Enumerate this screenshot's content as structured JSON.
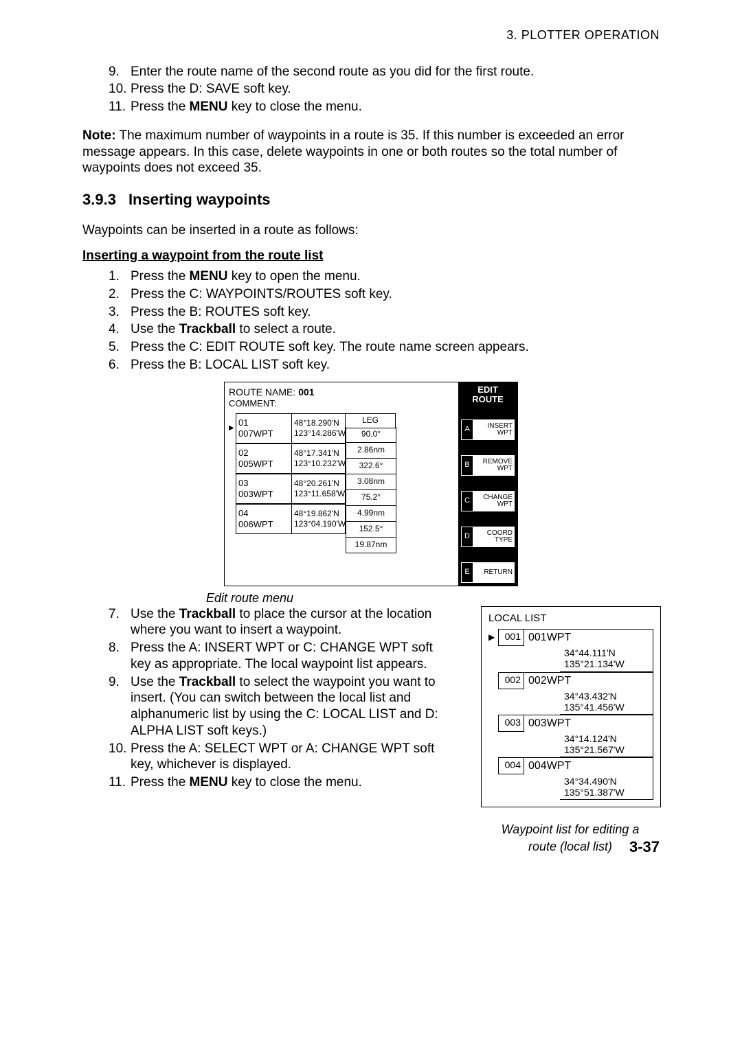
{
  "header": {
    "section_label": "3.  PLOTTER  OPERATION"
  },
  "steps_first": [
    {
      "num": "9.",
      "text": "Enter the route name of the second route as you did for the first route."
    },
    {
      "num": "10.",
      "text": "Press the D: SAVE soft key."
    },
    {
      "num": "11.",
      "text_pre": "Press the ",
      "bold": "MENU",
      "text_post": " key to close the menu."
    }
  ],
  "note": {
    "label": "Note:",
    "text": " The maximum number of waypoints in a route is 35. If this number is exceeded an error message appears. In this case, delete waypoints in one or both routes so the total number of waypoints does not exceed 35."
  },
  "section": {
    "num": "3.9.3",
    "title": "Inserting waypoints"
  },
  "intro": "Waypoints can be inserted in a route as follows:",
  "subhead": "Inserting a waypoint from the route list",
  "steps_second": [
    {
      "num": "1.",
      "pre": "Press the ",
      "bold": "MENU",
      "post": " key to open the menu."
    },
    {
      "num": "2.",
      "pre": "Press the C: WAYPOINTS/ROUTES soft key.",
      "bold": "",
      "post": ""
    },
    {
      "num": "3.",
      "pre": "Press the B: ROUTES soft key.",
      "bold": "",
      "post": ""
    },
    {
      "num": "4.",
      "pre": "Use the ",
      "bold": "Trackball",
      "post": " to select a route."
    },
    {
      "num": "5.",
      "pre": "Press the C: EDIT ROUTE soft key. The route name screen appears.",
      "bold": "",
      "post": ""
    },
    {
      "num": "6.",
      "pre": "Press the B: LOCAL LIST soft key.",
      "bold": "",
      "post": ""
    }
  ],
  "edit_route": {
    "route_name_label": "ROUTE NAME: ",
    "route_name": "001",
    "comment_label": "COMMENT:",
    "leg_header": "LEG",
    "rows": [
      {
        "idx": "01",
        "wpt": "007WPT",
        "lat": "48°18.290'N",
        "lon": "123°14.286'W"
      },
      {
        "idx": "02",
        "wpt": "005WPT",
        "lat": "48°17.341'N",
        "lon": "123°10.232'W"
      },
      {
        "idx": "03",
        "wpt": "003WPT",
        "lat": "48°20.261'N",
        "lon": "123°11.658'W"
      },
      {
        "idx": "04",
        "wpt": "006WPT",
        "lat": "48°19.862'N",
        "lon": "123°04.190'W"
      }
    ],
    "legs": [
      {
        "brg": "90.0°",
        "dst": "2.86nm"
      },
      {
        "brg": "322.6°",
        "dst": "3.08nm"
      },
      {
        "brg": "75.2°",
        "dst": "4.99nm"
      },
      {
        "brg": "152.5°",
        "dst": "19.87nm"
      }
    ],
    "right_title": "EDIT ROUTE",
    "soft_keys": [
      {
        "letter": "A",
        "label": "INSERT WPT"
      },
      {
        "letter": "B",
        "label": "REMOVE WPT"
      },
      {
        "letter": "C",
        "label": "CHANGE WPT"
      },
      {
        "letter": "D",
        "label": "COORD TYPE"
      },
      {
        "letter": "E",
        "label": "RETURN"
      }
    ],
    "caption": "Edit route menu"
  },
  "steps_third": [
    {
      "num": "7.",
      "pre": "Use the ",
      "bold": "Trackball",
      "post": " to place the cursor at the location where you want to insert a waypoint."
    },
    {
      "num": "8.",
      "pre": "Press the A: INSERT WPT or C: CHANGE WPT soft key as appropriate. The local waypoint list appears.",
      "bold": "",
      "post": ""
    },
    {
      "num": "9.",
      "pre": "Use the ",
      "bold": "Trackball",
      "post": " to select the waypoint you want to insert. (You can switch between the local list and alphanumeric list by using the C: LOCAL LIST and D: ALPHA LIST soft keys.)"
    },
    {
      "num": "10.",
      "pre": "Press the A: SELECT WPT or A: CHANGE WPT soft key, whichever is displayed.",
      "bold": "",
      "post": ""
    },
    {
      "num": "11.",
      "pre": "Press the ",
      "bold": "MENU",
      "post": " key to close the menu."
    }
  ],
  "local_list": {
    "title": "LOCAL LIST",
    "items": [
      {
        "num": "001",
        "name": "001WPT",
        "lat": "34°44.111'N",
        "lon": "135°21.134'W",
        "selected": true
      },
      {
        "num": "002",
        "name": "002WPT",
        "lat": "34°43.432'N",
        "lon": "135°41.456'W",
        "selected": false
      },
      {
        "num": "003",
        "name": "003WPT",
        "lat": "34°14.124'N",
        "lon": "135°21.567'W",
        "selected": false
      },
      {
        "num": "004",
        "name": "004WPT",
        "lat": "34°34.490'N",
        "lon": "135°51.387'W",
        "selected": false
      }
    ],
    "caption_line1": "Waypoint list for editing a",
    "caption_line2": "route (local list)"
  },
  "page_number": "3-37"
}
